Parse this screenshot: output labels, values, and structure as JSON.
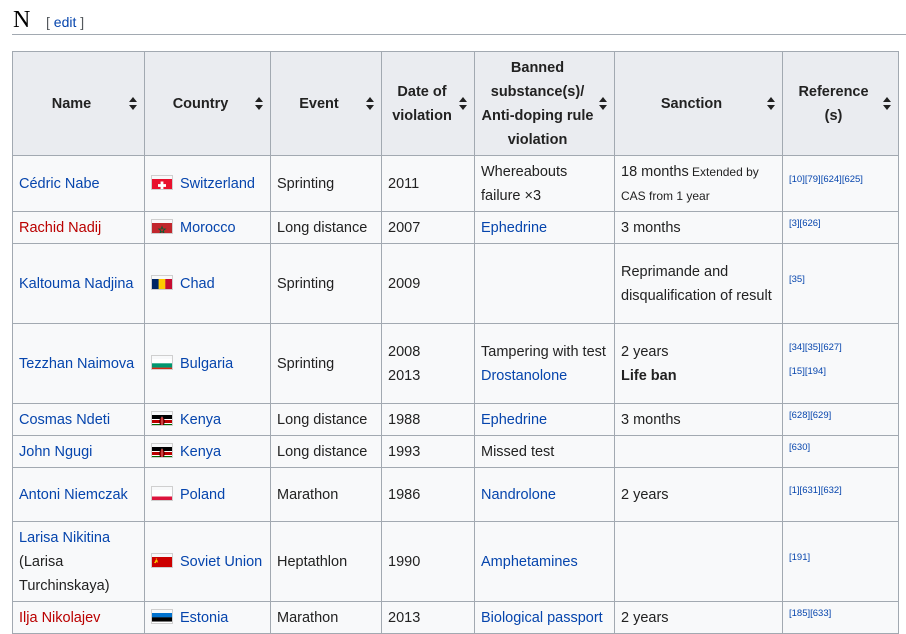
{
  "heading": {
    "letter": "N",
    "edit_open": "[",
    "edit_label": "edit",
    "edit_close": "]"
  },
  "columns": [
    "Name",
    "Country",
    "Event",
    "Date of violation",
    "Banned substance(s)/ Anti-doping rule violation",
    "Sanction",
    "Reference (s)"
  ],
  "rows": [
    {
      "name": [
        "Cédric Nabe"
      ],
      "name_style": "link",
      "country": "Switzerland",
      "flag": "switzerland",
      "event": "Sprinting",
      "dates": [
        "2011"
      ],
      "substance": [
        {
          "text": "Whereabouts failure ×3",
          "style": "plain"
        }
      ],
      "sanction": [
        {
          "text": "18 months",
          "style": "plain"
        },
        {
          "text": " Extended by CAS from 1 year",
          "style": "small"
        }
      ],
      "refs": [
        "[10][79][624][625]"
      ]
    },
    {
      "name": [
        "Rachid Nadij"
      ],
      "name_style": "new",
      "country": "Morocco",
      "flag": "morocco",
      "event": "Long distance",
      "dates": [
        "2007"
      ],
      "substance": [
        {
          "text": "Ephedrine",
          "style": "link"
        }
      ],
      "sanction": [
        {
          "text": "3 months",
          "style": "plain"
        }
      ],
      "refs": [
        "[3][626]"
      ]
    },
    {
      "name": [
        "Kaltouma Nadjina"
      ],
      "name_style": "link",
      "country": "Chad",
      "flag": "chad",
      "event": "Sprinting",
      "dates": [
        "2009"
      ],
      "substance": [],
      "sanction": [
        {
          "text": "Reprimande and disqualification of result",
          "style": "plain"
        }
      ],
      "refs": [
        "[35]"
      ]
    },
    {
      "name": [
        "Tezzhan Naimova"
      ],
      "name_style": "link",
      "country": "Bulgaria",
      "flag": "bulgaria",
      "event": "Sprinting",
      "dates": [
        "2008",
        "2013"
      ],
      "substance": [
        {
          "text": "Tampering with test",
          "style": "plain"
        },
        {
          "text": "Drostanolone",
          "style": "link"
        }
      ],
      "sanction": [
        {
          "text": "2 years",
          "style": "plain"
        },
        {
          "text": "Life ban",
          "style": "bold"
        }
      ],
      "refs": [
        "[34][35][627]",
        "[15][194]"
      ]
    },
    {
      "name": [
        "Cosmas Ndeti"
      ],
      "name_style": "link",
      "country": "Kenya",
      "flag": "kenya",
      "event": "Long distance",
      "dates": [
        "1988"
      ],
      "substance": [
        {
          "text": "Ephedrine",
          "style": "link"
        }
      ],
      "sanction": [
        {
          "text": "3 months",
          "style": "plain"
        }
      ],
      "refs": [
        "[628][629]"
      ]
    },
    {
      "name": [
        "John Ngugi"
      ],
      "name_style": "link",
      "country": "Kenya",
      "flag": "kenya",
      "event": "Long distance",
      "dates": [
        "1993"
      ],
      "substance": [
        {
          "text": "Missed test",
          "style": "plain"
        }
      ],
      "sanction": [],
      "refs": [
        "[630]"
      ]
    },
    {
      "name": [
        "Antoni Niemczak"
      ],
      "name_style": "link",
      "country": "Poland",
      "flag": "poland",
      "event": "Marathon",
      "dates": [
        "1986"
      ],
      "substance": [
        {
          "text": "Nandrolone",
          "style": "link"
        }
      ],
      "sanction": [
        {
          "text": "2 years",
          "style": "plain"
        }
      ],
      "refs": [
        "[1][631][632]"
      ]
    },
    {
      "name": [
        "Larisa Nikitina",
        "(Larisa Turchinskaya)"
      ],
      "name_style": "link",
      "country": "Soviet Union",
      "flag": "soviet",
      "event": "Heptathlon",
      "dates": [
        "1990"
      ],
      "substance": [
        {
          "text": "Amphetamines",
          "style": "link"
        }
      ],
      "sanction": [],
      "refs": [
        "[191]"
      ]
    },
    {
      "name": [
        "Ilja Nikolajev"
      ],
      "name_style": "new",
      "country": "Estonia",
      "flag": "estonia",
      "event": "Marathon",
      "dates": [
        "2013"
      ],
      "substance": [
        {
          "text": "Biological passport",
          "style": "link"
        }
      ],
      "sanction": [
        {
          "text": "2 years",
          "style": "plain"
        }
      ],
      "refs": [
        "[185][633]"
      ]
    }
  ],
  "colors": {
    "link": "#0645ad",
    "new_link": "#ba0000",
    "header_bg": "#eaecf0",
    "cell_bg": "#f8f9fa",
    "border": "#a2a9b1"
  }
}
